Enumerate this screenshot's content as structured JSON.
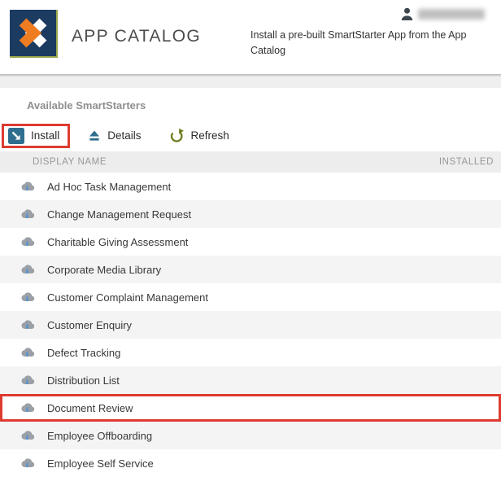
{
  "header": {
    "title": "APP CATALOG",
    "description": "Install a pre-built SmartStarter App from the App Catalog",
    "user": {
      "name_redacted": true
    }
  },
  "section": {
    "title": "Available SmartStarters"
  },
  "toolbar": {
    "buttons": [
      {
        "label": "Install",
        "icon": "install-arrow-icon",
        "highlighted": true
      },
      {
        "label": "Details",
        "icon": "eject-triangle-icon",
        "highlighted": false
      },
      {
        "label": "Refresh",
        "icon": "circular-arrow-icon",
        "highlighted": false
      }
    ]
  },
  "table": {
    "columns": [
      "DISPLAY NAME",
      "INSTALLED"
    ],
    "row_icon": "cloud-download-icon",
    "rows": [
      {
        "name": "Ad Hoc Task Management",
        "installed": "",
        "highlighted": false
      },
      {
        "name": "Change Management Request",
        "installed": "",
        "highlighted": false
      },
      {
        "name": "Charitable Giving Assessment",
        "installed": "",
        "highlighted": false
      },
      {
        "name": "Corporate Media Library",
        "installed": "",
        "highlighted": false
      },
      {
        "name": "Customer Complaint Management",
        "installed": "",
        "highlighted": false
      },
      {
        "name": "Customer Enquiry",
        "installed": "",
        "highlighted": false
      },
      {
        "name": "Defect Tracking",
        "installed": "",
        "highlighted": false
      },
      {
        "name": "Distribution List",
        "installed": "",
        "highlighted": false
      },
      {
        "name": "Document Review",
        "installed": "",
        "highlighted": true
      },
      {
        "name": "Employee Offboarding",
        "installed": "",
        "highlighted": false
      },
      {
        "name": "Employee Self Service",
        "installed": "",
        "highlighted": false
      }
    ]
  },
  "icons": {
    "logo": "k2-x-logo",
    "user": "person-silhouette",
    "install": "square-arrow-down-right",
    "details": "eject",
    "refresh": "circular-arrow",
    "row": "cloud-download"
  },
  "colors": {
    "annotation_red": "#de3b30",
    "accent_teal": "#2f6e8e",
    "refresh_olive": "#6f7d1f",
    "logo_navy": "#1c3b60",
    "logo_orange": "#f07c22",
    "header_bar_bg": "#ededed",
    "alt_row_bg": "#f4f4f4"
  }
}
